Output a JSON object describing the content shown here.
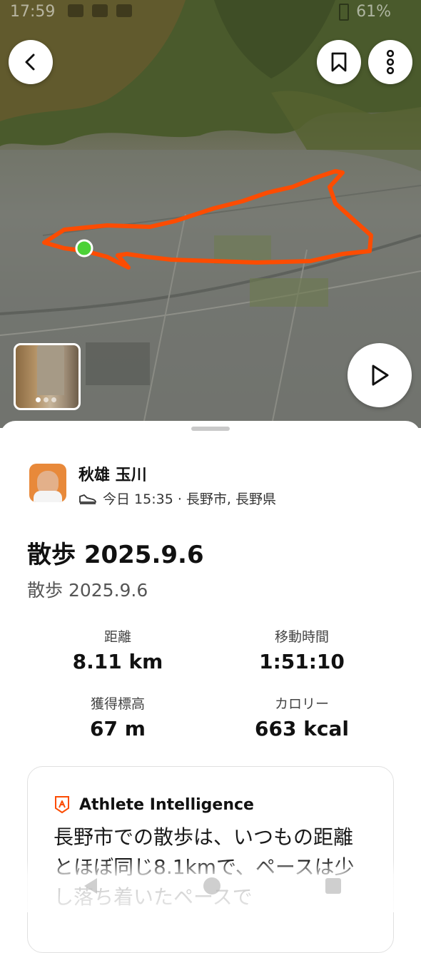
{
  "status_bar": {
    "time": "17:59",
    "battery": "61%"
  },
  "map": {
    "route_color": "#fc4c02",
    "start_marker_color": "#4cd137",
    "photo_count": 3
  },
  "athlete": {
    "name": "秋雄 玉川"
  },
  "activity": {
    "meta": "今日 15:35 · 長野市, 長野県",
    "title": "散歩 2025.9.6",
    "description": "散歩 2025.9.6"
  },
  "stats": [
    {
      "label": "距離",
      "value": "8.11 km"
    },
    {
      "label": "移動時間",
      "value": "1:51:10"
    },
    {
      "label": "獲得標高",
      "value": "67 m"
    },
    {
      "label": "カロリー",
      "value": "663 kcal"
    }
  ],
  "athlete_intelligence": {
    "title": "Athlete Intelligence",
    "text": "長野市での散歩は、いつもの距離とほぼ同じ8.1kmで、ペースは少し落ち着いたペースで"
  },
  "icons": {
    "back": "chevron-left-icon",
    "bookmark": "bookmark-icon",
    "more": "more-vertical-icon",
    "play": "play-icon",
    "shoe": "shoe-icon",
    "ai": "athlete-intelligence-icon"
  },
  "colors": {
    "accent": "#fc4c02",
    "text": "#111111"
  }
}
